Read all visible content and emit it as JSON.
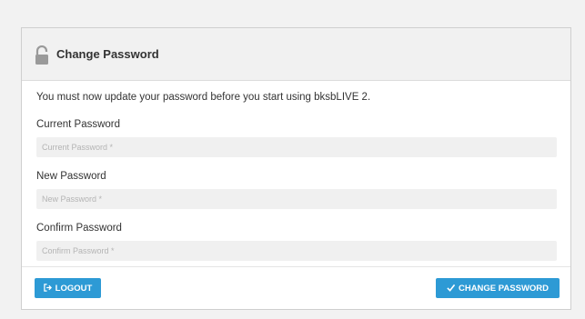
{
  "panel": {
    "title": "Change Password",
    "icon": "lock-open-icon"
  },
  "form": {
    "intro": "You must now update your password before you start using bksbLIVE 2.",
    "current": {
      "label": "Current Password",
      "placeholder": "Current Password *",
      "value": ""
    },
    "new": {
      "label": "New Password",
      "placeholder": "New Password *",
      "value": ""
    },
    "confirm": {
      "label": "Confirm Password",
      "placeholder": "Confirm Password *",
      "value": ""
    }
  },
  "footer": {
    "logout_label": "LOGOUT",
    "logout_icon": "sign-out-icon",
    "change_label": "CHANGE PASSWORD",
    "change_icon": "check-icon"
  },
  "colors": {
    "accent": "#2d9ad5",
    "header_bg": "#f1f1f1",
    "page_bg": "#f2f2f2",
    "input_bg": "#f0f0f0"
  }
}
